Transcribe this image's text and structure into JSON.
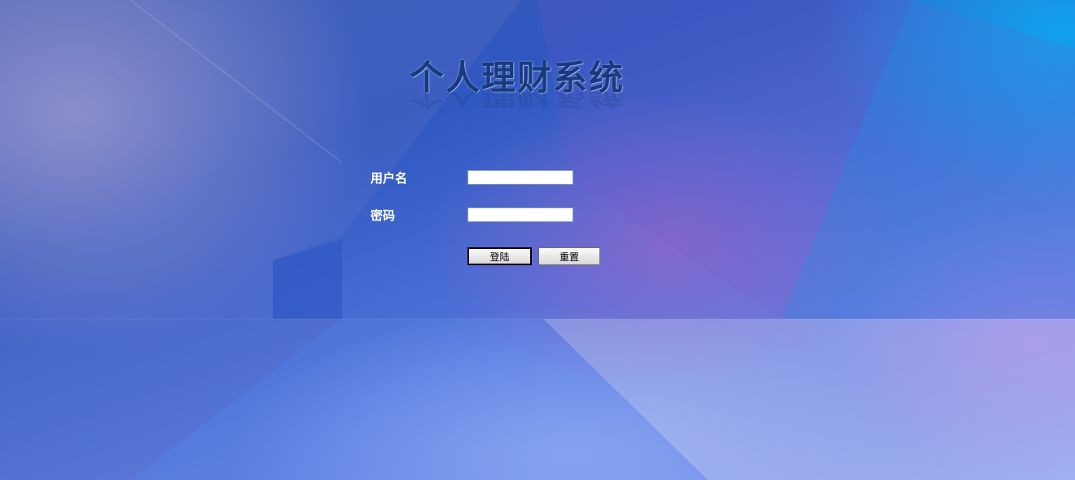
{
  "app": {
    "title": "个人理财系统"
  },
  "login_form": {
    "username_label": "用户名",
    "username_value": "",
    "password_label": "密码",
    "password_value": "",
    "login_button": "登陆",
    "reset_button": "重置"
  },
  "colors": {
    "title_text": "#1b3a7e",
    "label_text": "#ffffff",
    "background_primary": "#3a6fd8"
  }
}
